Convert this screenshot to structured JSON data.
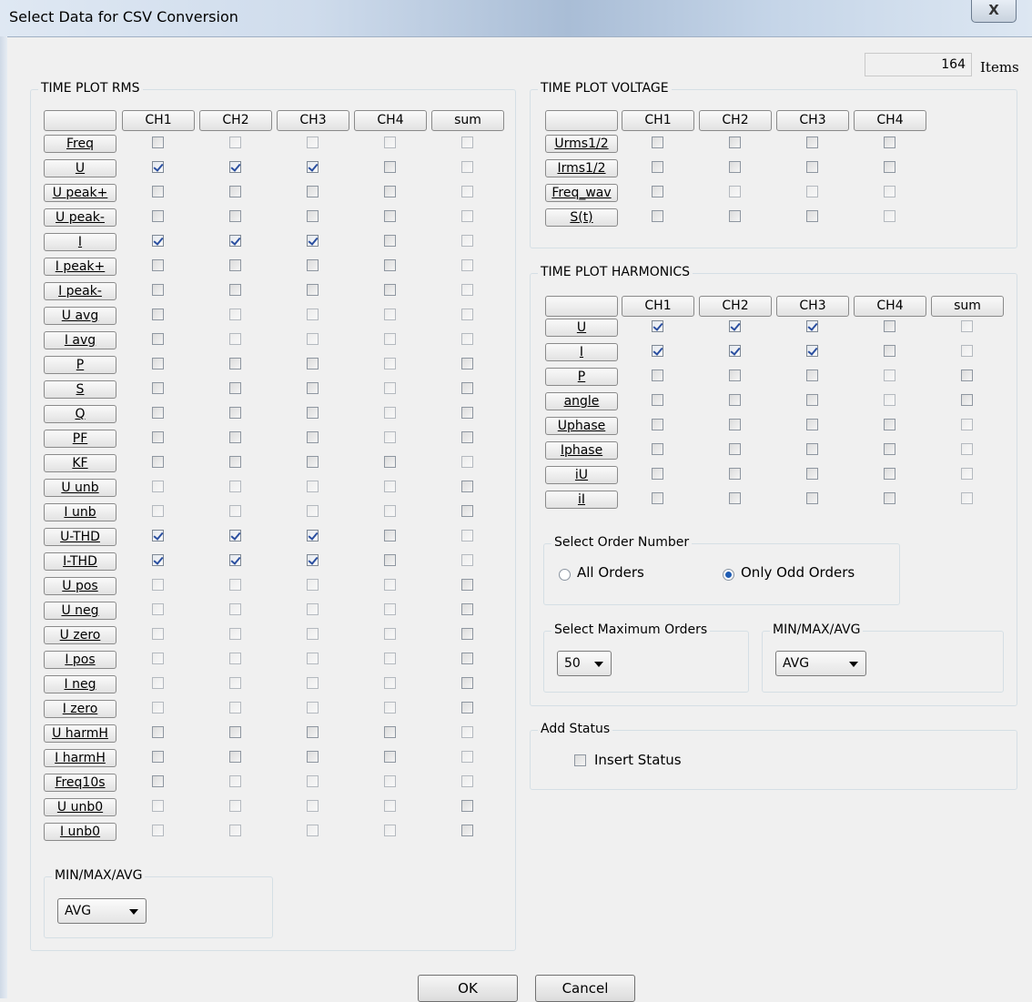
{
  "window": {
    "title": "Select Data for CSV Conversion",
    "close_label": "X"
  },
  "items": {
    "count": "164",
    "label": "Items"
  },
  "rms": {
    "title": "TIME PLOT RMS",
    "columns": [
      "",
      "CH1",
      "CH2",
      "CH3",
      "CH4",
      "sum"
    ],
    "rows": [
      {
        "label": "Freq",
        "states": [
          "en",
          "dis",
          "dis",
          "dis",
          "dis"
        ]
      },
      {
        "label": "U",
        "states": [
          "chk",
          "chk",
          "chk",
          "en",
          "dis"
        ]
      },
      {
        "label": "U peak+",
        "states": [
          "en",
          "en",
          "en",
          "en",
          "dis"
        ]
      },
      {
        "label": "U peak-",
        "states": [
          "en",
          "en",
          "en",
          "en",
          "dis"
        ]
      },
      {
        "label": "I",
        "states": [
          "chk",
          "chk",
          "chk",
          "en",
          "dis"
        ]
      },
      {
        "label": "I peak+",
        "states": [
          "en",
          "en",
          "en",
          "en",
          "dis"
        ]
      },
      {
        "label": "I peak-",
        "states": [
          "en",
          "en",
          "en",
          "en",
          "dis"
        ]
      },
      {
        "label": "U avg",
        "states": [
          "en",
          "dis",
          "dis",
          "dis",
          "dis"
        ]
      },
      {
        "label": "I avg",
        "states": [
          "en",
          "dis",
          "dis",
          "dis",
          "dis"
        ]
      },
      {
        "label": "P",
        "states": [
          "en",
          "en",
          "en",
          "dis",
          "en"
        ]
      },
      {
        "label": "S",
        "states": [
          "en",
          "en",
          "en",
          "dis",
          "en"
        ]
      },
      {
        "label": "Q",
        "states": [
          "en",
          "en",
          "en",
          "dis",
          "en"
        ]
      },
      {
        "label": "PF",
        "states": [
          "en",
          "en",
          "en",
          "dis",
          "en"
        ]
      },
      {
        "label": "KF",
        "states": [
          "en",
          "en",
          "en",
          "en",
          "dis"
        ]
      },
      {
        "label": "U unb",
        "states": [
          "dis",
          "dis",
          "dis",
          "dis",
          "en"
        ]
      },
      {
        "label": "I unb",
        "states": [
          "dis",
          "dis",
          "dis",
          "dis",
          "en"
        ]
      },
      {
        "label": "U-THD",
        "states": [
          "chk",
          "chk",
          "chk",
          "en",
          "dis"
        ]
      },
      {
        "label": "I-THD",
        "states": [
          "chk",
          "chk",
          "chk",
          "en",
          "dis"
        ]
      },
      {
        "label": "U pos",
        "states": [
          "dis",
          "dis",
          "dis",
          "dis",
          "en"
        ]
      },
      {
        "label": "U neg",
        "states": [
          "dis",
          "dis",
          "dis",
          "dis",
          "en"
        ]
      },
      {
        "label": "U zero",
        "states": [
          "dis",
          "dis",
          "dis",
          "dis",
          "en"
        ]
      },
      {
        "label": "I pos",
        "states": [
          "dis",
          "dis",
          "dis",
          "dis",
          "en"
        ]
      },
      {
        "label": "I neg",
        "states": [
          "dis",
          "dis",
          "dis",
          "dis",
          "en"
        ]
      },
      {
        "label": "I zero",
        "states": [
          "dis",
          "dis",
          "dis",
          "dis",
          "en"
        ]
      },
      {
        "label": "U harmH",
        "states": [
          "en",
          "en",
          "en",
          "en",
          "dis"
        ]
      },
      {
        "label": "I harmH",
        "states": [
          "en",
          "en",
          "en",
          "en",
          "dis"
        ]
      },
      {
        "label": "Freq10s",
        "states": [
          "en",
          "dis",
          "dis",
          "dis",
          "dis"
        ]
      },
      {
        "label": "U unb0",
        "states": [
          "dis",
          "dis",
          "dis",
          "dis",
          "en"
        ]
      },
      {
        "label": "I unb0",
        "states": [
          "dis",
          "dis",
          "dis",
          "dis",
          "en"
        ]
      }
    ],
    "minmax": {
      "title": "MIN/MAX/AVG",
      "value": "AVG"
    }
  },
  "voltage": {
    "title": "TIME PLOT VOLTAGE",
    "columns": [
      "",
      "CH1",
      "CH2",
      "CH3",
      "CH4"
    ],
    "rows": [
      {
        "label": "Urms1/2",
        "states": [
          "en",
          "en",
          "en",
          "en"
        ]
      },
      {
        "label": "Irms1/2",
        "states": [
          "en",
          "en",
          "en",
          "en"
        ]
      },
      {
        "label": "Freq_wav",
        "states": [
          "en",
          "dis",
          "dis",
          "dis"
        ]
      },
      {
        "label": "S(t)",
        "states": [
          "en",
          "en",
          "en",
          "dis"
        ]
      }
    ]
  },
  "harmonics": {
    "title": "TIME PLOT HARMONICS",
    "columns": [
      "",
      "CH1",
      "CH2",
      "CH3",
      "CH4",
      "sum"
    ],
    "rows": [
      {
        "label": "U",
        "states": [
          "chk",
          "chk",
          "chk",
          "en",
          "dis"
        ]
      },
      {
        "label": "I",
        "states": [
          "chk",
          "chk",
          "chk",
          "en",
          "dis"
        ]
      },
      {
        "label": "P",
        "states": [
          "en",
          "en",
          "en",
          "dis",
          "en"
        ]
      },
      {
        "label": "angle",
        "states": [
          "en",
          "en",
          "en",
          "dis",
          "en"
        ]
      },
      {
        "label": "Uphase",
        "states": [
          "en",
          "en",
          "en",
          "en",
          "dis"
        ]
      },
      {
        "label": "Iphase",
        "states": [
          "en",
          "en",
          "en",
          "en",
          "dis"
        ]
      },
      {
        "label": "iU",
        "states": [
          "en",
          "en",
          "en",
          "en",
          "dis"
        ]
      },
      {
        "label": "iI",
        "states": [
          "en",
          "en",
          "en",
          "en",
          "dis"
        ]
      }
    ],
    "order": {
      "title": "Select Order Number",
      "all_label": "All Orders",
      "odd_label": "Only Odd Orders",
      "selected": "odd"
    },
    "max_orders": {
      "title": "Select Maximum Orders",
      "value": "50"
    },
    "minmax": {
      "title": "MIN/MAX/AVG",
      "value": "AVG"
    }
  },
  "status": {
    "title": "Add Status",
    "insert_label": "Insert Status",
    "checked": false
  },
  "footer": {
    "ok_label": "OK",
    "cancel_label": "Cancel"
  }
}
